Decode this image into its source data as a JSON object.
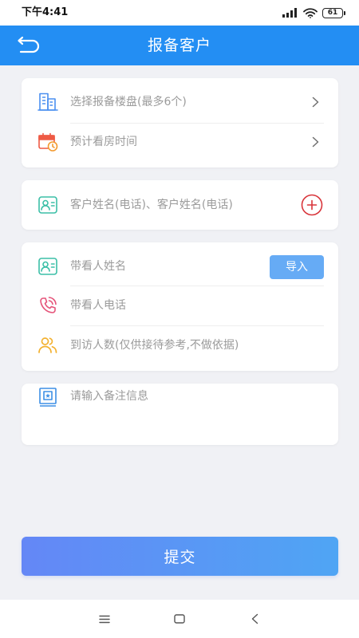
{
  "status_bar": {
    "time": "下午4:41",
    "battery": "61",
    "icons": [
      "signal-icon",
      "wifi-icon",
      "battery-icon"
    ]
  },
  "header": {
    "title": "报备客户",
    "back_icon": "back-arrow-icon"
  },
  "project_card": {
    "project": {
      "placeholder": "选择报备楼盘(最多6个)",
      "icon": "building-icon",
      "trailing_icon": "chevron-right-icon"
    },
    "visit_time": {
      "placeholder": "预计看房时间",
      "icon": "calendar-clock-icon",
      "trailing_icon": "chevron-right-icon"
    }
  },
  "customer_card": {
    "customer": {
      "placeholder": "客户姓名(电话)、客户姓名(电话)",
      "value": "",
      "icon": "contact-card-icon",
      "trailing_icon": "add-circle-icon"
    }
  },
  "guide_card": {
    "guide_name": {
      "placeholder": "带看人姓名",
      "value": "",
      "icon": "contact-card-icon",
      "import_label": "导入"
    },
    "guide_phone": {
      "placeholder": "带看人电话",
      "value": "",
      "icon": "phone-waves-icon"
    },
    "visitor_count": {
      "placeholder": "到访人数(仅供接待参考,不做依据)",
      "value": "",
      "icon": "people-icon"
    }
  },
  "remark_card": {
    "remark": {
      "placeholder": "请输入备注信息",
      "value": "",
      "icon": "note-icon"
    }
  },
  "submit": {
    "label": "提交"
  },
  "nav_bar": {
    "icons": [
      "menu-icon",
      "home-square-icon",
      "back-chevron-icon"
    ]
  },
  "colors": {
    "header_bg": "#238ef3",
    "page_bg": "#f0f1f5",
    "placeholder_text": "#9b9b9b",
    "import_button_bg": "#66abf5",
    "submit_gradient_start": "#6487f6",
    "submit_gradient_end": "#4fa5f4",
    "add_icon": "#d8343a"
  }
}
